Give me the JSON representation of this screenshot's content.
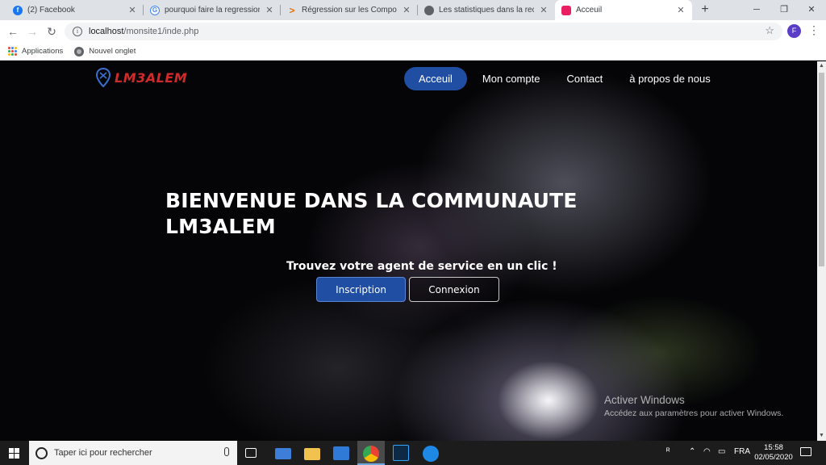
{
  "browser": {
    "tabs": [
      {
        "title": "(2) Facebook",
        "icon": "facebook-icon",
        "color": "#1877f2"
      },
      {
        "title": "pourquoi faire la regression lo",
        "icon": "google-icon",
        "color": "#4285f4"
      },
      {
        "title": "Régression sur les Composante",
        "icon": "chevron-right-icon",
        "color": "#e8710a"
      },
      {
        "title": "Les statistiques dans la recherc",
        "icon": "globe-icon",
        "color": "#5f6368"
      },
      {
        "title": "Acceuil",
        "icon": "site-icon",
        "color": "#e91e63"
      }
    ],
    "url_host": "localhost",
    "url_path": "/monsite1/inde.php",
    "profile_initial": "F",
    "bookmarks": [
      "Applications",
      "Nouvel onglet"
    ]
  },
  "site": {
    "brand": "LM3ALEM",
    "nav": [
      "Acceuil",
      "Mon compte",
      "Contact",
      "à propos de nous"
    ],
    "hero_title": "BIENVENUE DANS LA COMMUNAUTE LM3ALEM",
    "hero_subtitle": "Trouvez votre agent de service en un clic !",
    "btn_signup": "Inscription",
    "btn_login": "Connexion"
  },
  "watermark": {
    "title": "Activer Windows",
    "subtitle": "Accédez aux paramètres pour activer Windows."
  },
  "taskbar": {
    "search_placeholder": "Taper ici pour rechercher",
    "language": "FRA",
    "time": "15:58",
    "date": "02/05/2020"
  },
  "colors": {
    "accent": "#1f4ea3",
    "brand": "#d12a2a"
  }
}
